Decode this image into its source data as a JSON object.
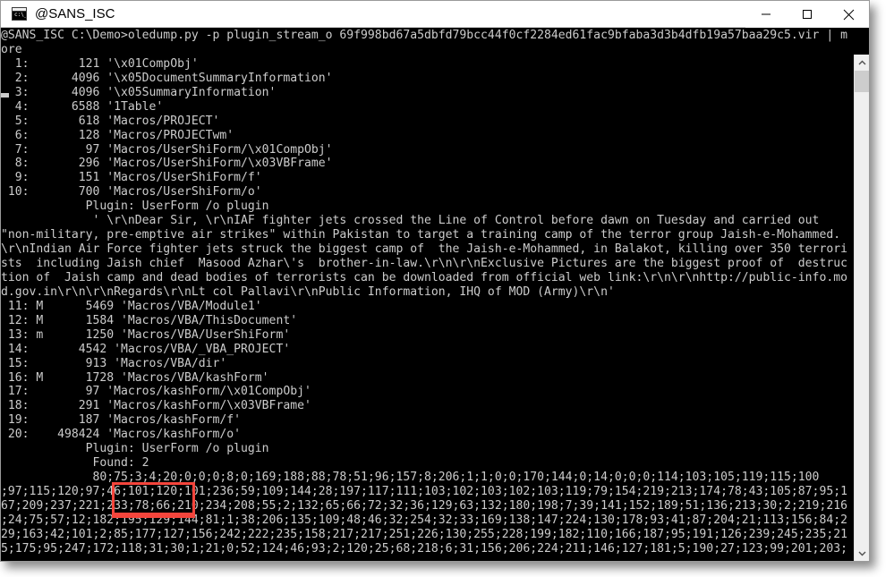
{
  "window": {
    "title": "@SANS_ISC",
    "icon": "console-icon",
    "controls": {
      "minimize": "minimize-button",
      "maximize": "maximize-button",
      "close": "close-button"
    }
  },
  "terminal": {
    "prompt": "@SANS_ISC C:\\Demo>",
    "command": "oledump.py -p plugin_stream_o 69f998bd67a5dbfd79bcc44f0cf2284ed61fac9bfaba3d3b4dfb19a57baa29c5.vir | more",
    "lines": [
      "@SANS_ISC C:\\Demo>oledump.py -p plugin_stream_o 69f998bd67a5dbfd79bcc44f0cf2284ed61fac9bfaba3d3b4dfb19a57baa29c5.vir | m",
      "ore",
      "  1:       121 '\\x01CompObj'",
      "  2:      4096 '\\x05DocumentSummaryInformation'",
      "  3:      4096 '\\x05SummaryInformation'",
      "  4:      6588 '1Table'",
      "  5:       618 'Macros/PROJECT'",
      "  6:       128 'Macros/PROJECTwm'",
      "  7:        97 'Macros/UserShiForm/\\x01CompObj'",
      "  8:       296 'Macros/UserShiForm/\\x03VBFrame'",
      "  9:       151 'Macros/UserShiForm/f'",
      " 10:       700 'Macros/UserShiForm/o'",
      "            Plugin: UserForm /o plugin",
      "             ' \\r\\nDear Sir, \\r\\nIAF fighter jets crossed the Line of Control before dawn on Tuesday and carried out",
      "\"non-military, pre-emptive air strikes\" within Pakistan to target a training camp of the terror group Jaish-e-Mohammed.",
      "\\r\\nIndian Air Force fighter jets struck the biggest camp of  the Jaish-e-Mohammed, in Balakot, killing over 350 terrori",
      "sts  including Jaish chief  Masood Azhar\\'s  brother-in-law.\\r\\n\\r\\nExclusive Pictures are the biggest proof of  destruc",
      "tion of  Jaish camp and dead bodies of terrorists can be downloaded from official web link:\\r\\n\\r\\nhttp://public-info.mo",
      "d.gov.in\\r\\n\\r\\nRegards\\r\\nLt col Pallavi\\r\\nPublic Information, IHQ of MOD (Army)\\r\\n'",
      " 11: M      5469 'Macros/VBA/Module1'",
      " 12: M      1584 'Macros/VBA/ThisDocument'",
      " 13: m      1250 'Macros/VBA/UserShiForm'",
      " 14:       4542 'Macros/VBA/_VBA_PROJECT'",
      " 15:        913 'Macros/VBA/dir'",
      " 16: M      1728 'Macros/VBA/kashForm'",
      " 17:        97 'Macros/kashForm/\\x01CompObj'",
      " 18:       291 'Macros/kashForm/\\x03VBFrame'",
      " 19:       187 'Macros/kashForm/f'",
      " 20:    498424 'Macros/kashForm/o'",
      "            Plugin: UserForm /o plugin",
      "             Found: 2",
      "             80;75;3;4;20;0;0;0;8;0;169;188;88;78;51;96;157;8;206;1;1;0;0;170;144;0;14;0;0;0;114;103;105;119;115;100",
      ";97;115;120;97;46;101;120;101;236;59;109;144;28;197;117;111;103;102;103;102;103;119;79;154;219;213;174;78;43;105;87;95;1",
      "67;209;237;221;233;78;66;210;234;208;55;2;132;65;66;72;32;36;129;63;132;180;198;7;39;141;152;189;51;136;213;30;2;219;216",
      ";24;75;57;12;182;195;129;144;81;1;38;206;135;109;48;46;32;254;32;33;169;138;147;224;130;178;93;41;87;204;21;113;156;84;2",
      "29;163;42;101;2;85;177;127;156;242;222;235;158;217;217;251;226;130;255;228;199;182;110;166;187;95;191;126;239;245;235;21",
      "5;175;95;247;172;118;31;30;1;21;0;52;124;46;93;2;120;25;68;218;6;31;156;206;224;211;146;127;181;5;190;27;123;99;201;203;"
    ],
    "highlight": {
      "label": "found-highlight",
      "text_line_1": "Found: 2",
      "text_line_2": "80;75;3;4",
      "color": "#f4453c"
    }
  },
  "scrollbar": {
    "up_arrow": "scroll-up-arrow",
    "down_arrow": "scroll-down-arrow",
    "thumb": "scroll-thumb"
  }
}
